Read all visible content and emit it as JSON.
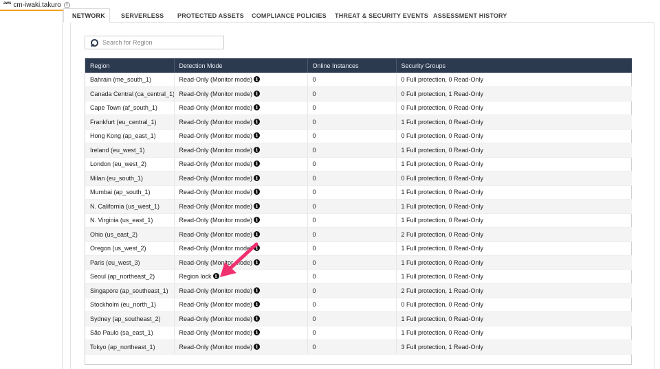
{
  "account_tab": {
    "logo_text": "aws",
    "name": "cm-iwaki.takuro",
    "close_glyph": "×"
  },
  "tabs": [
    {
      "label": "NETWORK",
      "active": true
    },
    {
      "label": "SERVERLESS",
      "active": false
    },
    {
      "label": "PROTECTED ASSETS",
      "active": false
    },
    {
      "label": "COMPLIANCE POLICIES",
      "active": false
    },
    {
      "label": "THREAT & SECURITY EVENTS",
      "active": false
    },
    {
      "label": "ASSESSMENT HISTORY",
      "active": false
    }
  ],
  "search": {
    "placeholder": "Search for Region",
    "value": ""
  },
  "table": {
    "columns": [
      "Region",
      "Detection Mode",
      "Online Instances",
      "Security Groups"
    ],
    "rows": [
      {
        "region": "Bahrain (me_south_1)",
        "mode": "Read-Only (Monitor mode)",
        "instances": "0",
        "groups": "0 Full protection, 0 Read-Only"
      },
      {
        "region": "Canada Central (ca_central_1)",
        "mode": "Read-Only (Monitor mode)",
        "instances": "0",
        "groups": "0 Full protection, 1 Read-Only"
      },
      {
        "region": "Cape Town (af_south_1)",
        "mode": "Read-Only (Monitor mode)",
        "instances": "0",
        "groups": "0 Full protection, 0 Read-Only"
      },
      {
        "region": "Frankfurt (eu_central_1)",
        "mode": "Read-Only (Monitor mode)",
        "instances": "0",
        "groups": "1 Full protection, 0 Read-Only"
      },
      {
        "region": "Hong Kong (ap_east_1)",
        "mode": "Read-Only (Monitor mode)",
        "instances": "0",
        "groups": "0 Full protection, 0 Read-Only"
      },
      {
        "region": "Ireland (eu_west_1)",
        "mode": "Read-Only (Monitor mode)",
        "instances": "0",
        "groups": "1 Full protection, 0 Read-Only"
      },
      {
        "region": "London (eu_west_2)",
        "mode": "Read-Only (Monitor mode)",
        "instances": "0",
        "groups": "1 Full protection, 0 Read-Only"
      },
      {
        "region": "Milan (eu_south_1)",
        "mode": "Read-Only (Monitor mode)",
        "instances": "0",
        "groups": "0 Full protection, 0 Read-Only"
      },
      {
        "region": "Mumbai (ap_south_1)",
        "mode": "Read-Only (Monitor mode)",
        "instances": "0",
        "groups": "1 Full protection, 0 Read-Only"
      },
      {
        "region": "N. California (us_west_1)",
        "mode": "Read-Only (Monitor mode)",
        "instances": "0",
        "groups": "1 Full protection, 0 Read-Only"
      },
      {
        "region": "N. Virginia (us_east_1)",
        "mode": "Read-Only (Monitor mode)",
        "instances": "0",
        "groups": "1 Full protection, 0 Read-Only"
      },
      {
        "region": "Ohio (us_east_2)",
        "mode": "Read-Only (Monitor mode)",
        "instances": "0",
        "groups": "2 Full protection, 0 Read-Only"
      },
      {
        "region": "Oregon (us_west_2)",
        "mode": "Read-Only (Monitor mode)",
        "instances": "0",
        "groups": "1 Full protection, 0 Read-Only"
      },
      {
        "region": "Paris (eu_west_3)",
        "mode": "Read-Only (Monitor mode)",
        "instances": "0",
        "groups": "1 Full protection, 0 Read-Only"
      },
      {
        "region": "Seoul (ap_northeast_2)",
        "mode": "Region lock",
        "instances": "0",
        "groups": "1 Full protection, 0 Read-Only"
      },
      {
        "region": "Singapore (ap_southeast_1)",
        "mode": "Read-Only (Monitor mode)",
        "instances": "0",
        "groups": "2 Full protection, 1 Read-Only"
      },
      {
        "region": "Stockholm (eu_north_1)",
        "mode": "Read-Only (Monitor mode)",
        "instances": "0",
        "groups": "0 Full protection, 0 Read-Only"
      },
      {
        "region": "Sydney (ap_southeast_2)",
        "mode": "Read-Only (Monitor mode)",
        "instances": "0",
        "groups": "1 Full protection, 0 Read-Only"
      },
      {
        "region": "São Paulo (sa_east_1)",
        "mode": "Read-Only (Monitor mode)",
        "instances": "0",
        "groups": "1 Full protection, 0 Read-Only"
      },
      {
        "region": "Tokyo (ap_northeast_1)",
        "mode": "Read-Only (Monitor mode)",
        "instances": "0",
        "groups": "3 Full protection, 1 Read-Only"
      }
    ]
  },
  "colors": {
    "header_bg": "#2c3a4f",
    "tab_underline": "#f0a020",
    "annotation_arrow": "#f0306f"
  },
  "icons": {
    "info": "info-icon",
    "search": "search-icon",
    "close": "close-icon"
  }
}
